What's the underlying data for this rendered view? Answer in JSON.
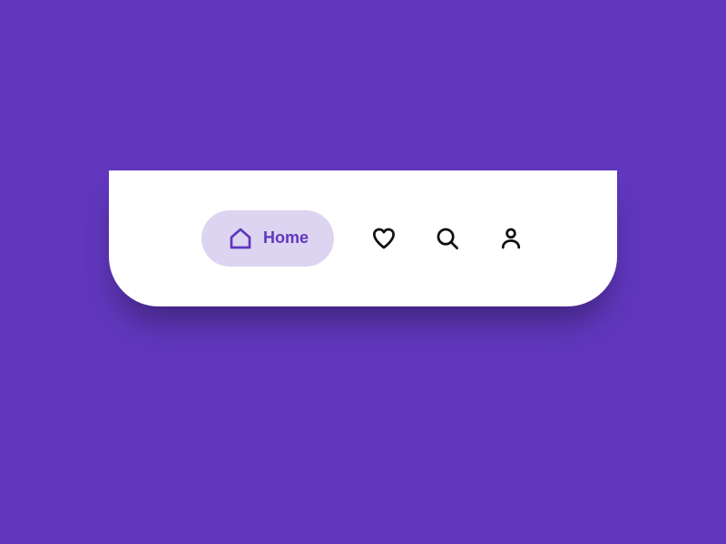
{
  "colors": {
    "background": "#6037bd",
    "surface": "#ffffff",
    "active_pill": "#dcd4f0",
    "active_icon": "#6037bd",
    "inactive_icon": "#111111"
  },
  "nav": {
    "items": [
      {
        "id": "home",
        "label": "Home",
        "icon": "home-icon",
        "active": true
      },
      {
        "id": "favorites",
        "label": "Favorites",
        "icon": "heart-icon",
        "active": false
      },
      {
        "id": "search",
        "label": "Search",
        "icon": "search-icon",
        "active": false
      },
      {
        "id": "profile",
        "label": "Profile",
        "icon": "user-icon",
        "active": false
      }
    ]
  }
}
